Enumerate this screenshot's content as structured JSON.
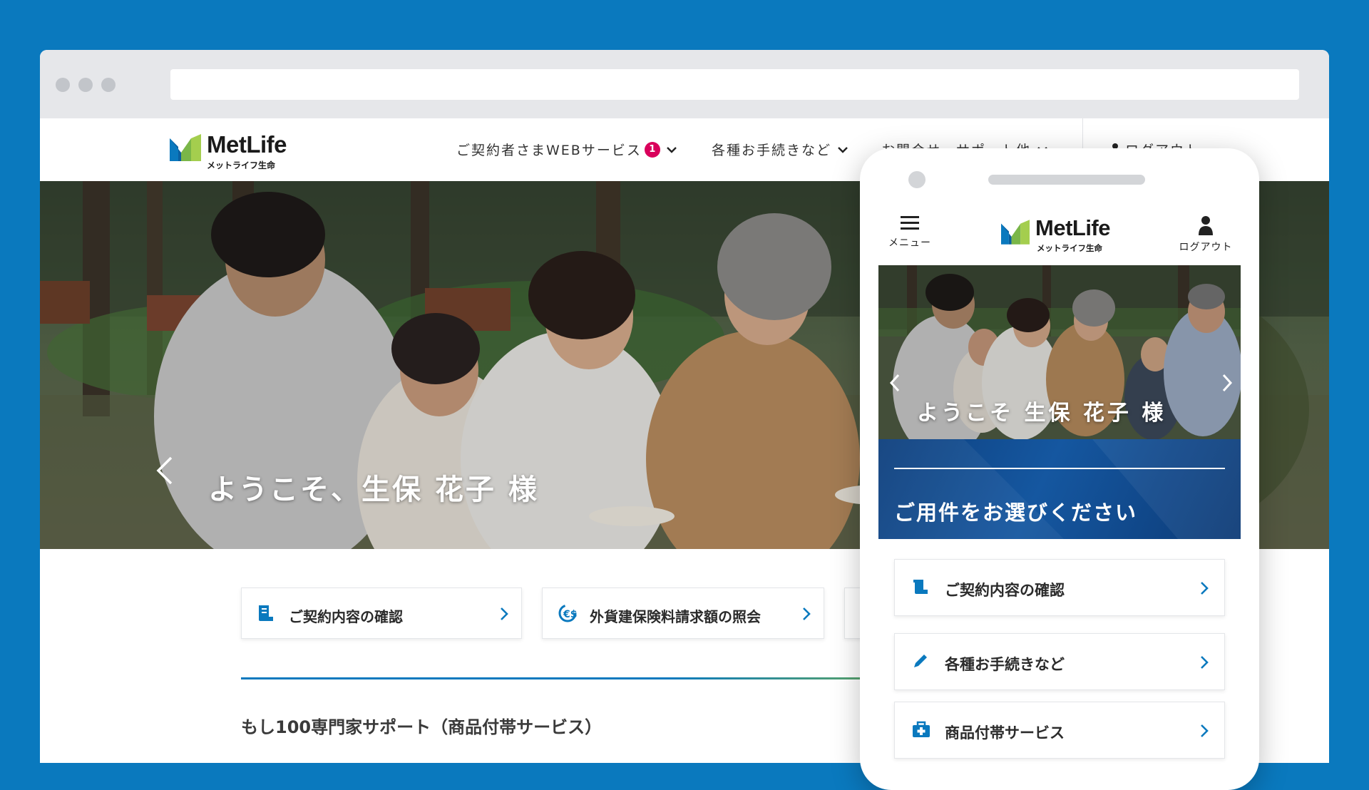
{
  "brand": {
    "name": "MetLife",
    "subtitle": "メットライフ生命",
    "colors": {
      "blue": "#0a79be",
      "green": "#7ab648",
      "navy": "#0d3f7d",
      "badge": "#d9005b"
    }
  },
  "desktop": {
    "nav": {
      "contract_web": "ご契約者さまWEBサービス",
      "contract_web_badge": "1",
      "procedures": "各種お手続きなど",
      "inquiry": "お問合せ・サポート他",
      "logout": "ログアウト"
    },
    "hero": {
      "welcome": "ようこそ、生保 花子 様"
    },
    "cards": [
      {
        "label": "ご契約内容の確認",
        "icon": "document-icon"
      },
      {
        "label": "外貨建保険料請求額の照会",
        "icon": "currency-exchange-icon"
      }
    ],
    "section_title": "もし100専門家サポート（商品付帯サービス）"
  },
  "mobile": {
    "menu_label": "メニュー",
    "logout_label": "ログアウト",
    "hero": {
      "welcome": "ようこそ 生保 花子 様"
    },
    "select_prompt": "ご用件をお選びください",
    "cards": [
      {
        "label": "ご契約内容の確認",
        "icon": "document-icon"
      },
      {
        "label": "各種お手続きなど",
        "icon": "pencil-icon"
      },
      {
        "label": "商品付帯サービス",
        "icon": "first-aid-kit-icon"
      }
    ]
  }
}
